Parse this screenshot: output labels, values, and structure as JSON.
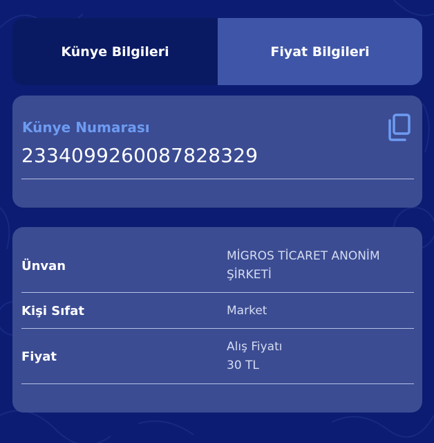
{
  "tabs": {
    "kunye_label": "Künye Bilgileri",
    "fiyat_label": "Fiyat Bilgileri"
  },
  "kunye_card": {
    "label": "Künye Numarası",
    "number": "2334099260087828329",
    "copy_icon": "copy-icon"
  },
  "info_card": {
    "rows": [
      {
        "label": "Ünvan",
        "value_lines": [
          "MİGROS TİCARET ANONİM",
          "ŞİRKETİ"
        ]
      },
      {
        "label": "Kişi Sıfat",
        "value_lines": [
          "Market"
        ]
      },
      {
        "label": "Fiyat",
        "value_lines": [
          "Alış Fiyatı",
          "30 TL"
        ]
      }
    ]
  },
  "colors": {
    "background": "#0b1c72",
    "tab_inactive": "#0a1a62",
    "tab_active": "#3f56a8",
    "card": "#3b4c92",
    "accent_label": "#6e9bf2"
  }
}
